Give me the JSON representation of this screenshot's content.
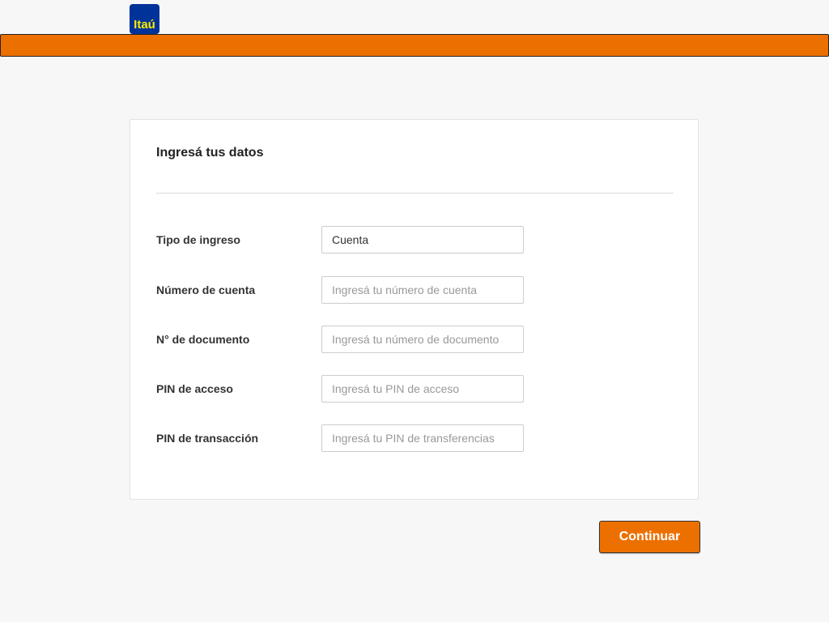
{
  "header": {
    "logo_text": "Itaú",
    "colors": {
      "logo_bg": "#003399",
      "logo_text": "#ffec00",
      "accent": "#ec7000"
    }
  },
  "form": {
    "title": "Ingresá tus datos",
    "fields": [
      {
        "label": "Tipo de ingreso",
        "value": "Cuenta",
        "placeholder": ""
      },
      {
        "label": "Número de cuenta",
        "value": "",
        "placeholder": "Ingresá tu número de cuenta"
      },
      {
        "label": "N° de documento",
        "value": "",
        "placeholder": "Ingresá tu número de documento"
      },
      {
        "label": "PIN de acceso",
        "value": "",
        "placeholder": "Ingresá tu PIN de acceso"
      },
      {
        "label": "PIN de transacción",
        "value": "",
        "placeholder": "Ingresá tu PIN de transferencias"
      }
    ]
  },
  "actions": {
    "continue_label": "Continuar"
  }
}
